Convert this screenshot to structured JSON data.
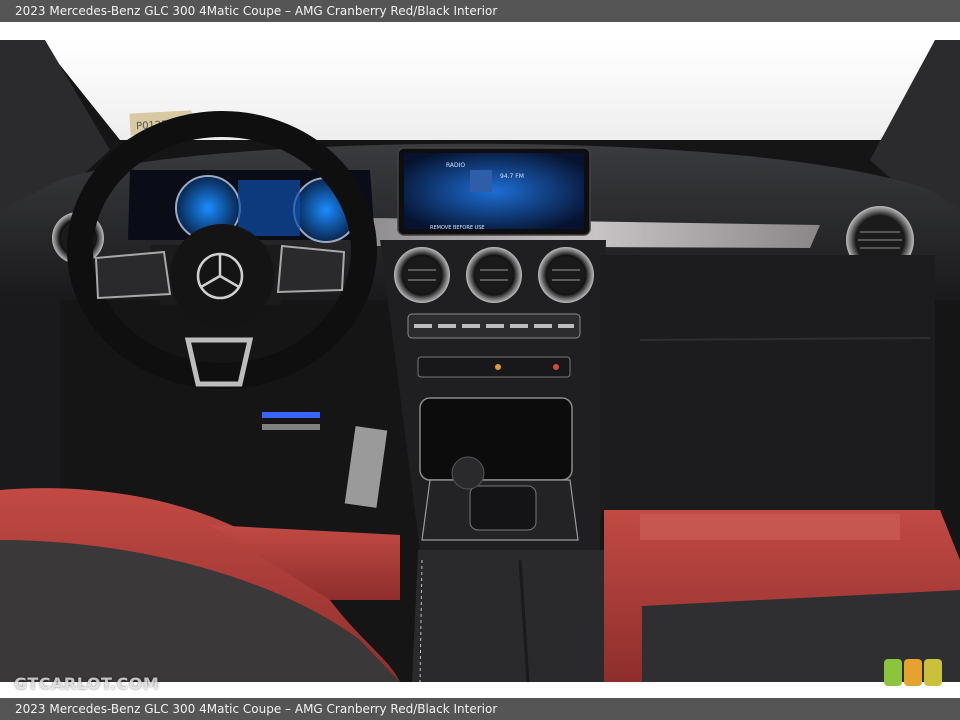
{
  "caption": {
    "top": "2023 Mercedes-Benz GLC 300 4Matic Coupe – AMG Cranberry Red/Black Interior",
    "bottom": "2023 Mercedes-Benz GLC 300 4Matic Coupe – AMG Cranberry Red/Black Interior"
  },
  "photo": {
    "alt": "2023 Mercedes-Benz GLC 300 4Matic Coupe – AMG Cranberry Red/Black Interior",
    "dash_tag": "P0125426",
    "screen_title": "RADIO",
    "screen_freq": "94.7 FM",
    "screen_footer": "REMOVE BEFORE USE"
  },
  "watermark": "GTCARLOT.COM",
  "logo": {
    "colors": [
      "#8cc43f",
      "#e3a32c",
      "#c9c13a"
    ]
  },
  "colors": {
    "caption_bg": "#555555",
    "leather_red": "#b8403c",
    "dash_black": "#1c1c1e"
  }
}
